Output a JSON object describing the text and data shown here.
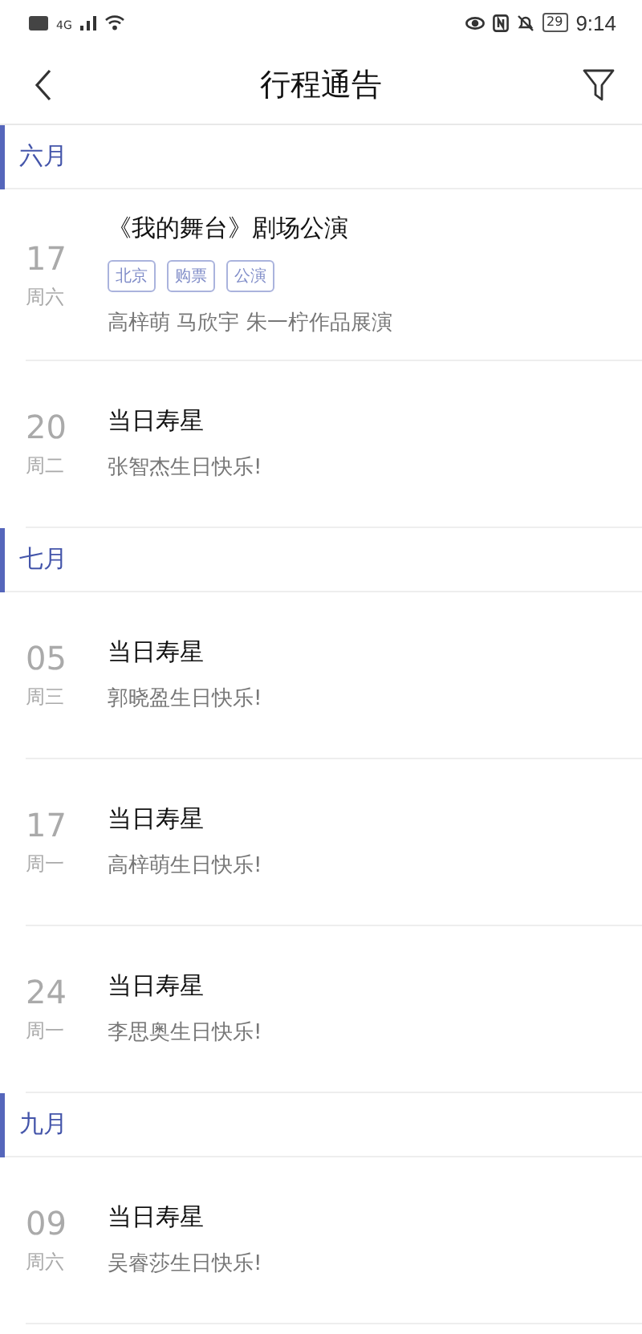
{
  "status_bar": {
    "network": "4G",
    "battery": "29",
    "time": "9:14"
  },
  "header": {
    "title": "行程通告"
  },
  "months": [
    {
      "label": "六月",
      "events": [
        {
          "day": "17",
          "weekday": "周六",
          "title": "《我的舞台》剧场公演",
          "tags": [
            "北京",
            "购票",
            "公演"
          ],
          "description": "高梓萌 马欣宇 朱一柠作品展演"
        },
        {
          "day": "20",
          "weekday": "周二",
          "title": "当日寿星",
          "description": "张智杰生日快乐!"
        }
      ]
    },
    {
      "label": "七月",
      "events": [
        {
          "day": "05",
          "weekday": "周三",
          "title": "当日寿星",
          "description": "郭晓盈生日快乐!"
        },
        {
          "day": "17",
          "weekday": "周一",
          "title": "当日寿星",
          "description": "高梓萌生日快乐!"
        },
        {
          "day": "24",
          "weekday": "周一",
          "title": "当日寿星",
          "description": "李思奥生日快乐!"
        }
      ]
    },
    {
      "label": "九月",
      "events": [
        {
          "day": "09",
          "weekday": "周六",
          "title": "当日寿星",
          "description": "吴睿莎生日快乐!"
        }
      ]
    }
  ]
}
